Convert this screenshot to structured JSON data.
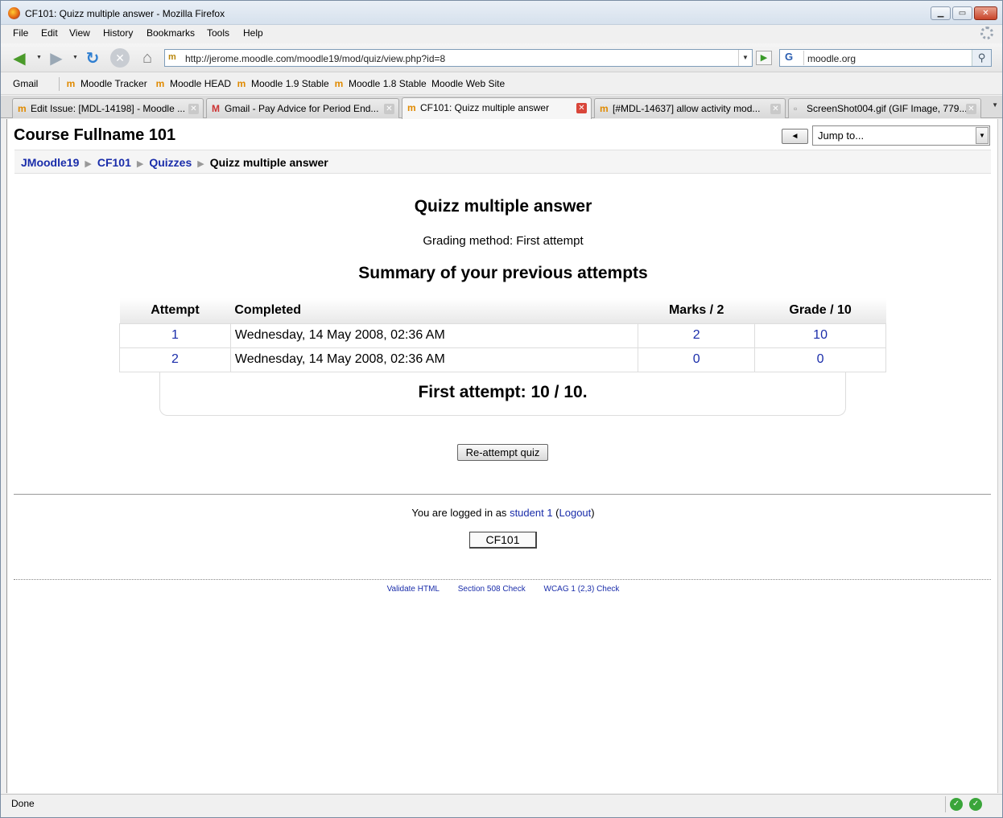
{
  "window": {
    "title": "CF101: Quizz multiple answer - Mozilla Firefox"
  },
  "menu": [
    "File",
    "Edit",
    "View",
    "History",
    "Bookmarks",
    "Tools",
    "Help"
  ],
  "navbar": {
    "url": "http://jerome.moodle.com/moodle19/mod/quiz/view.php?id=8",
    "search": "moodle.org"
  },
  "bookmarks": [
    "Gmail",
    "Moodle Tracker",
    "Moodle HEAD",
    "Moodle 1.9 Stable",
    "Moodle 1.8 Stable",
    "Moodle Web Site"
  ],
  "tabs": [
    {
      "label": "Edit Issue: [MDL-14198] - Moodle ...",
      "active": false
    },
    {
      "label": "Gmail - Pay Advice for Period End...",
      "active": false
    },
    {
      "label": "CF101: Quizz multiple answer",
      "active": true
    },
    {
      "label": "[#MDL-14637] allow activity mod...",
      "active": false
    },
    {
      "label": "ScreenShot004.gif (GIF Image, 779...",
      "active": false
    }
  ],
  "course": {
    "fullname": "Course Fullname 101",
    "jump_label": "Jump to...",
    "jump_back": "◄"
  },
  "breadcrumb": {
    "site": "JMoodle19",
    "course": "CF101",
    "module": "Quizzes",
    "current": "Quizz multiple answer"
  },
  "quiz": {
    "title": "Quizz multiple answer",
    "grading_method": "Grading method: First attempt",
    "summary_title": "Summary of your previous attempts",
    "columns": {
      "attempt": "Attempt",
      "completed": "Completed",
      "marks": "Marks / 2",
      "grade": "Grade / 10"
    },
    "rows": [
      {
        "attempt": "1",
        "completed": "Wednesday, 14 May 2008, 02:36 AM",
        "marks": "2",
        "grade": "10"
      },
      {
        "attempt": "2",
        "completed": "Wednesday, 14 May 2008, 02:36 AM",
        "marks": "0",
        "grade": "0"
      }
    ],
    "result": "First attempt: 10 / 10.",
    "reattempt_label": "Re-attempt quiz"
  },
  "footer": {
    "logged_in_prefix": "You are logged in as",
    "user": "student 1",
    "logout": "Logout",
    "course_button": "CF101",
    "validate_html": "Validate HTML",
    "section508": "Section 508 Check",
    "wcag": "WCAG 1 (2,3) Check"
  },
  "status": {
    "text": "Done"
  },
  "icons": {
    "back": "back-arrow-icon",
    "forward": "forward-arrow-icon",
    "reload": "reload-icon",
    "stop": "stop-icon",
    "home": "home-icon"
  },
  "colors": {
    "link": "#1a2daa",
    "close_tab": "#d9463a"
  }
}
